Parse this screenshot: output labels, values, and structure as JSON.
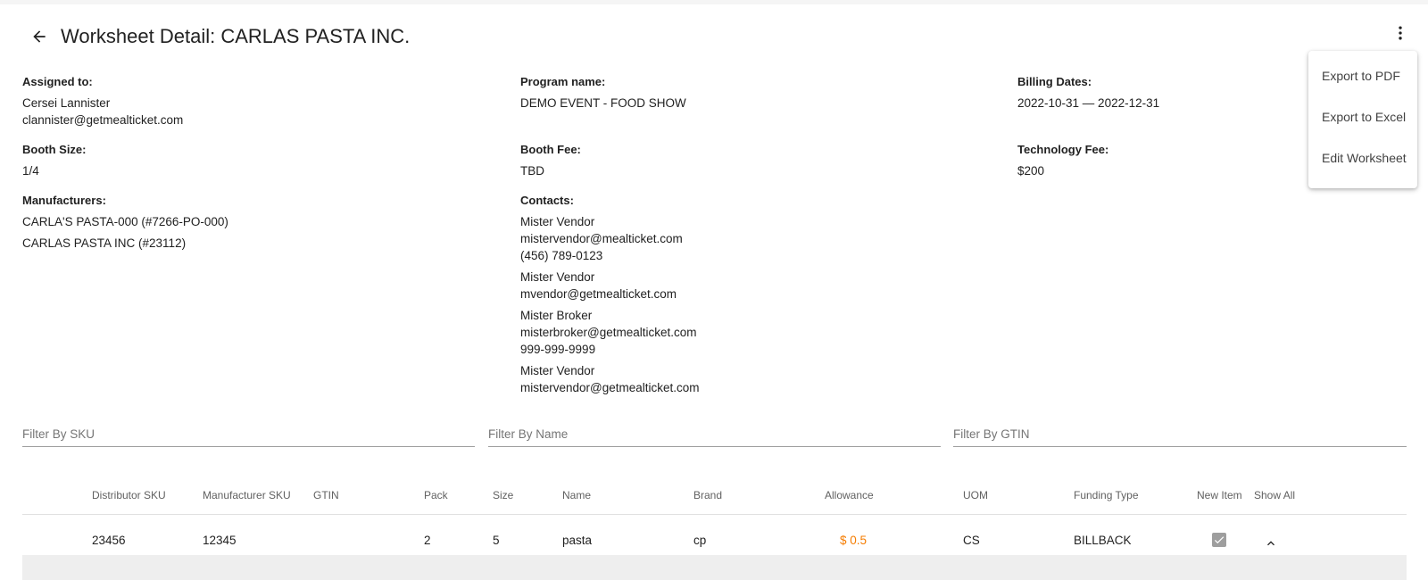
{
  "header": {
    "title": "Worksheet Detail: CARLAS PASTA INC.",
    "back_icon": "arrow-left-icon",
    "more_icon": "more-vertical-icon"
  },
  "menu": {
    "items": [
      {
        "label": "Export to PDF"
      },
      {
        "label": "Export to Excel"
      },
      {
        "label": "Edit Worksheet"
      }
    ]
  },
  "details": {
    "assigned_to": {
      "label": "Assigned to:",
      "name": "Cersei Lannister",
      "email": "clannister@getmealticket.com"
    },
    "program_name": {
      "label": "Program name:",
      "value": "DEMO EVENT - FOOD SHOW"
    },
    "billing_dates": {
      "label": "Billing Dates:",
      "value": "2022-10-31 — 2022-12-31"
    },
    "booth_size": {
      "label": "Booth Size:",
      "value": "1/4"
    },
    "booth_fee": {
      "label": "Booth Fee:",
      "value": "TBD"
    },
    "technology_fee": {
      "label": "Technology Fee:",
      "value": "$200"
    },
    "manufacturers": {
      "label": "Manufacturers:",
      "items": [
        "CARLA'S PASTA-000 (#7266-PO-000)",
        "CARLAS PASTA INC (#23112)"
      ]
    },
    "contacts": {
      "label": "Contacts:",
      "items": [
        {
          "name": "Mister Vendor",
          "email": "mistervendor@mealticket.com",
          "phone": "(456) 789-0123"
        },
        {
          "name": "Mister Vendor",
          "email": "mvendor@getmealticket.com"
        },
        {
          "name": "Mister Broker",
          "email": "misterbroker@getmealticket.com",
          "phone": "999-999-9999"
        },
        {
          "name": "Mister Vendor",
          "email": "mistervendor@getmealticket.com"
        }
      ]
    }
  },
  "filters": {
    "sku_placeholder": "Filter By SKU",
    "name_placeholder": "Filter By Name",
    "gtin_placeholder": "Filter By GTIN"
  },
  "table": {
    "columns": [
      "Distributor SKU",
      "Manufacturer SKU",
      "GTIN",
      "Pack",
      "Size",
      "Name",
      "Brand",
      "Allowance",
      "UOM",
      "Funding Type",
      "New Item",
      "Show All"
    ],
    "rows": [
      {
        "distributor_sku": "23456",
        "manufacturer_sku": "12345",
        "gtin": "",
        "pack": "2",
        "size": "5",
        "name": "pasta",
        "brand": "cp",
        "allowance": "$ 0.5",
        "uom": "CS",
        "funding_type": "BILLBACK",
        "new_item": true
      }
    ]
  },
  "colors": {
    "allowance": "#f57c00",
    "checkbox": "#9e9e9e"
  }
}
